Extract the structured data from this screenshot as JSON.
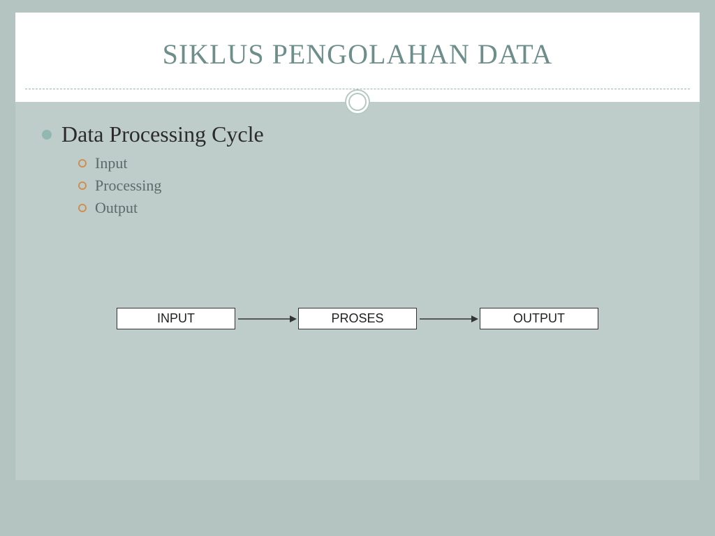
{
  "slide": {
    "title": "SIKLUS PENGOLAHAN DATA",
    "main_bullet": "Data Processing Cycle",
    "sub_bullets": [
      "Input",
      "Processing",
      "Output"
    ],
    "flow": {
      "boxes": [
        "INPUT",
        "PROSES",
        "OUTPUT"
      ]
    }
  },
  "colors": {
    "accent": "#92b8b2",
    "sub_bullet_ring": "#cf8f52",
    "title": "#6d8e8a",
    "content_bg": "#bfcdca"
  }
}
